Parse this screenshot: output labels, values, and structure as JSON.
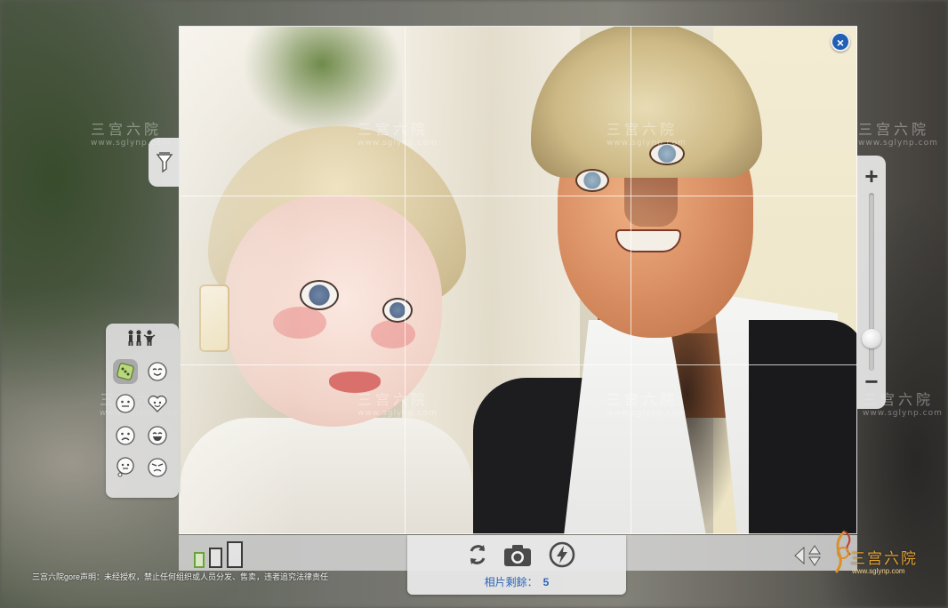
{
  "camera": {
    "close_label": "×",
    "zoom_in_label": "+",
    "zoom_out_label": "−",
    "zoom_level": 0.18,
    "photos_left_label": "相片剩餘：",
    "photos_left_count": "5",
    "frame_ratios": [
      "small-landscape",
      "square",
      "portrait"
    ],
    "selected_ratio": 0
  },
  "expressions": {
    "header_icon": "sims-group-icon",
    "items": [
      {
        "name": "random-dice-icon",
        "selected": true
      },
      {
        "name": "happy-face-icon"
      },
      {
        "name": "neutral-face-icon"
      },
      {
        "name": "heart-face-icon"
      },
      {
        "name": "sad-face-icon"
      },
      {
        "name": "grin-face-icon"
      },
      {
        "name": "thought-face-icon"
      },
      {
        "name": "angry-face-icon"
      }
    ]
  },
  "toolbar": {
    "rotate_icon": "rotate-icon",
    "camera_icon": "camera-icon",
    "flash_icon": "flash-icon",
    "arrows_icon": "move-arrows-icon",
    "filter_icon": "filter-funnel-icon"
  },
  "watermark": {
    "text": "三宫六院",
    "url": "www.sglynp.com",
    "disclaimer": "三宫六院gore声明：未经授权，禁止任何组织或人员分发、售卖，违者追究法律责任",
    "logo_text": "三宫六院",
    "logo_url": "www.sglynp.com"
  },
  "colors": {
    "accent_blue": "#2a63b6",
    "selected_green": "#6aa33a",
    "close_blue": "#1f5fb4"
  }
}
